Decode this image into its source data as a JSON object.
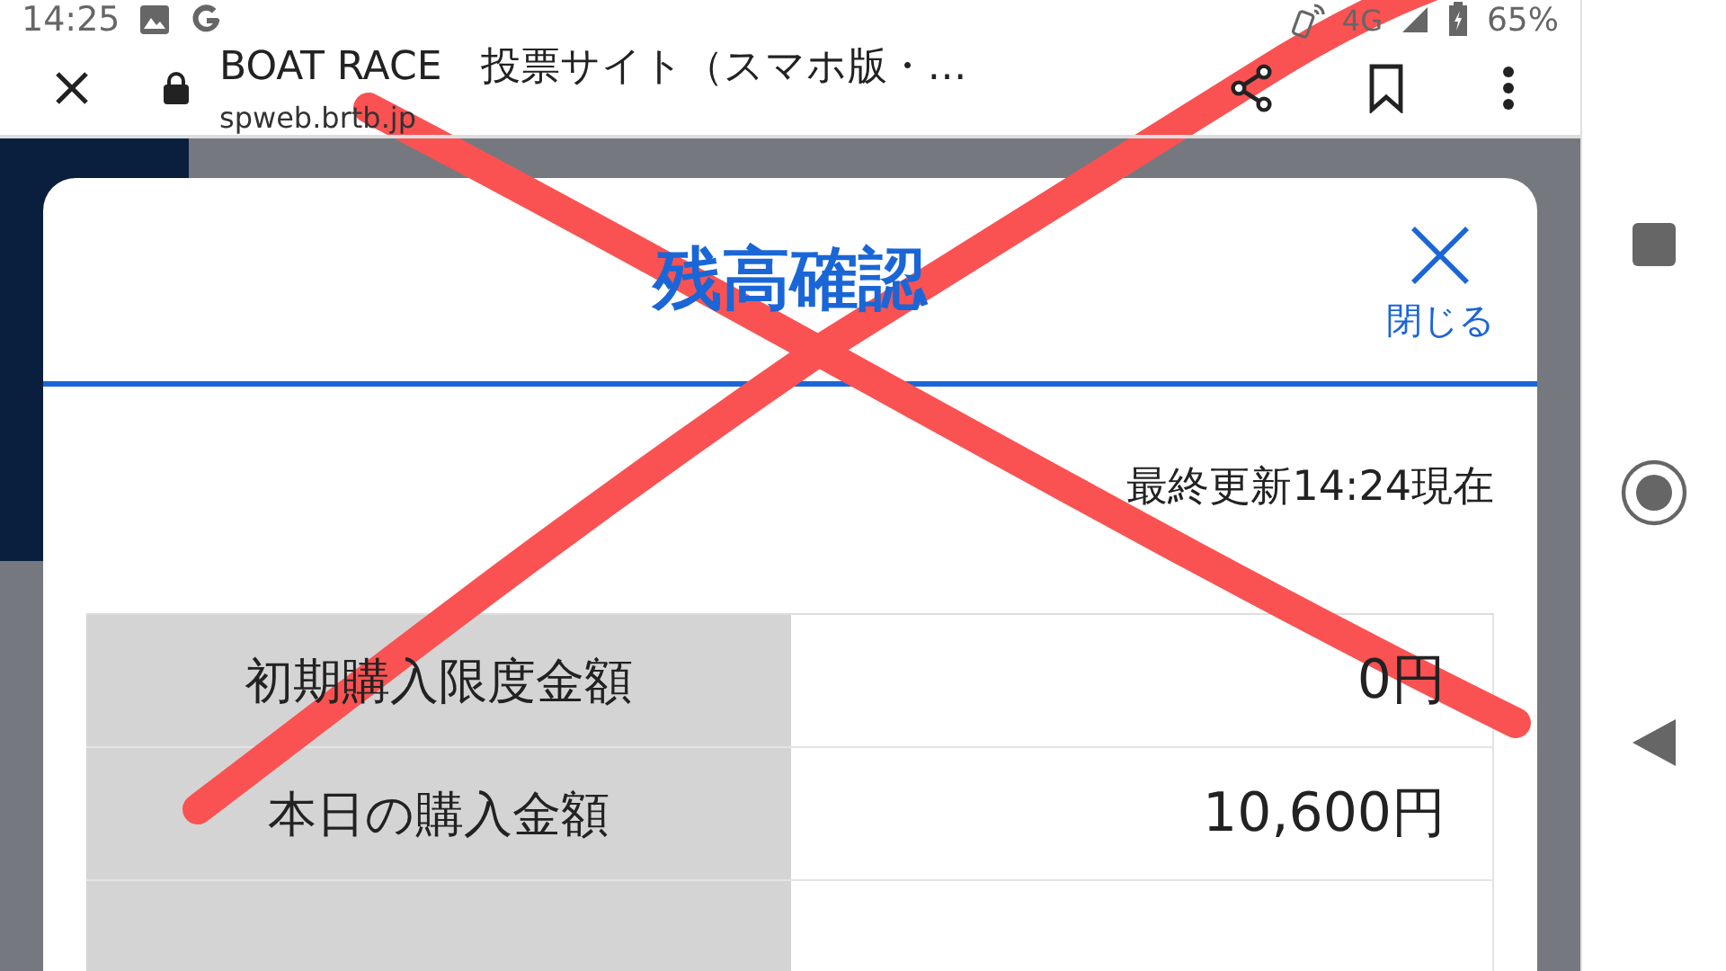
{
  "status_bar": {
    "time": "14:25",
    "network": "4G",
    "battery": "65%"
  },
  "browser": {
    "title": "BOAT RACE　投票サイト（スマホ版・…",
    "url": "spweb.brtb.jp"
  },
  "modal": {
    "title": "残高確認",
    "close_label": "閉じる",
    "updated": "最終更新14:24現在",
    "rows": [
      {
        "label": "初期購入限度金額",
        "value": "0円"
      },
      {
        "label": "本日の購入金額",
        "value": "10,600円"
      }
    ]
  },
  "annotation": {
    "kind": "cross"
  }
}
